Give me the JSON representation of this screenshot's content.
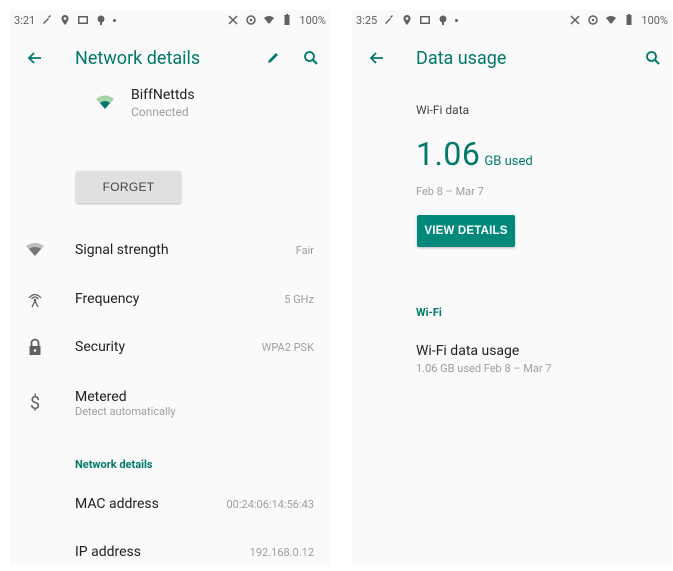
{
  "left": {
    "status_time": "3:21",
    "status_battery": "100%",
    "title": "Network details",
    "network": {
      "name": "BiffNettds",
      "status": "Connected"
    },
    "forget_label": "FORGET",
    "rows": [
      {
        "label": "Signal strength",
        "value": "Fair"
      },
      {
        "label": "Frequency",
        "value": "5 GHz"
      },
      {
        "label": "Security",
        "value": "WPA2 PSK"
      },
      {
        "label": "Metered",
        "sub": "Detect automatically"
      }
    ],
    "section_title": "Network details",
    "details": [
      {
        "label": "MAC address",
        "value": "00:24:06:14:56:43"
      },
      {
        "label": "IP address",
        "value": "192.168.0.12"
      }
    ]
  },
  "right": {
    "status_time": "3:25",
    "status_battery": "100%",
    "title": "Data usage",
    "wifi_data_label": "Wi-Fi data",
    "amount": "1.06",
    "unit": "GB used",
    "dates": "Feb 8 – Mar 7",
    "view_details_label": "VIEW DETAILS",
    "section_title": "Wi-Fi",
    "usage_title": "Wi-Fi data usage",
    "usage_sub": "1.06 GB used Feb 8 – Mar 7"
  },
  "colors": {
    "accent": "#00796b",
    "button": "#00897b"
  }
}
